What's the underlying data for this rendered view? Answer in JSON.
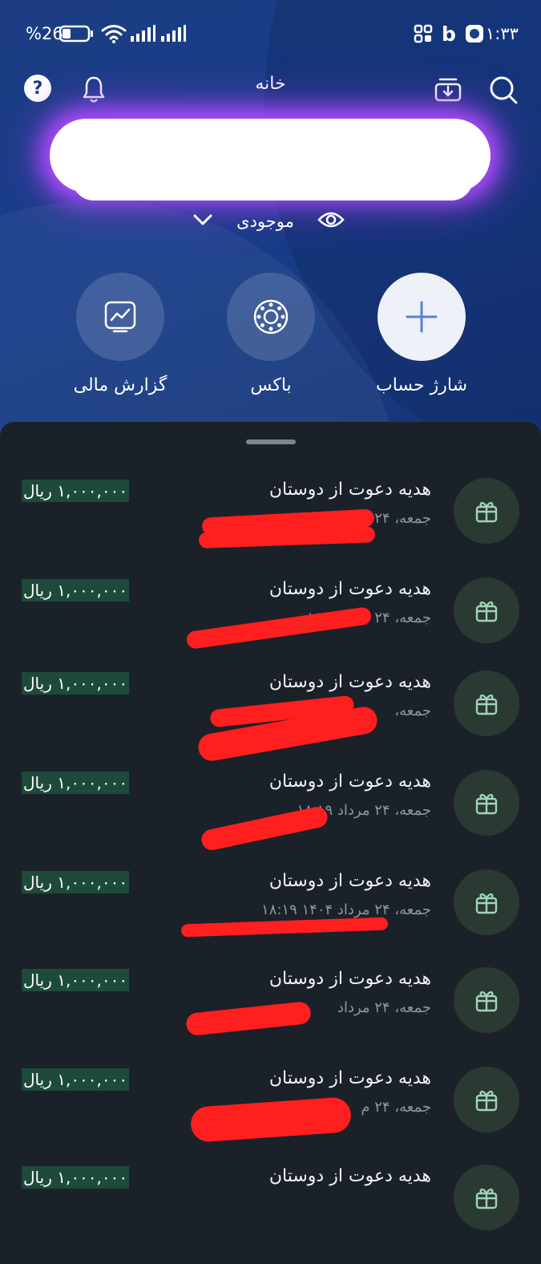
{
  "status_bar": {
    "battery_percent": "%26",
    "time": "۱:۳۳",
    "letter": "b"
  },
  "header": {
    "title": "خانه"
  },
  "balance": {
    "label": "موجودی"
  },
  "actions": [
    {
      "label": "شارژ حساب",
      "icon": "plus-icon"
    },
    {
      "label": "باکس",
      "icon": "box-icon"
    },
    {
      "label": "گزارش مالی",
      "icon": "chart-icon"
    }
  ],
  "transactions": [
    {
      "title": "هدیه دعوت از دوستان",
      "date": "جمعه، ۲۴ م",
      "amount": "۱,۰۰۰,۰۰۰ ریال"
    },
    {
      "title": "هدیه دعوت از دوستان",
      "date": "جمعه، ۲۴ مرد ۱۸:۱۹",
      "amount": "۱,۰۰۰,۰۰۰ ریال"
    },
    {
      "title": "هدیه دعوت از دوستان",
      "date": "جمعه،",
      "amount": "۱,۰۰۰,۰۰۰ ریال"
    },
    {
      "title": "هدیه دعوت از دوستان",
      "date": "جمعه، ۲۴ مرداد ۱۸:۱۹",
      "amount": "۱,۰۰۰,۰۰۰ ریال"
    },
    {
      "title": "هدیه دعوت از دوستان",
      "date": "جمعه، ۲۴ مرداد ۱۴۰۴ ۱۸:۱۹",
      "amount": "۱,۰۰۰,۰۰۰ ریال"
    },
    {
      "title": "هدیه دعوت از دوستان",
      "date": "جمعه، ۲۴ مرداد",
      "amount": "۱,۰۰۰,۰۰۰ ریال"
    },
    {
      "title": "هدیه دعوت از دوستان",
      "date": "جمعه، ۲۴ م",
      "amount": "۱,۰۰۰,۰۰۰ ریال"
    },
    {
      "title": "هدیه دعوت از دوستان",
      "date": "",
      "amount": "۱,۰۰۰,۰۰۰ ریال"
    }
  ]
}
